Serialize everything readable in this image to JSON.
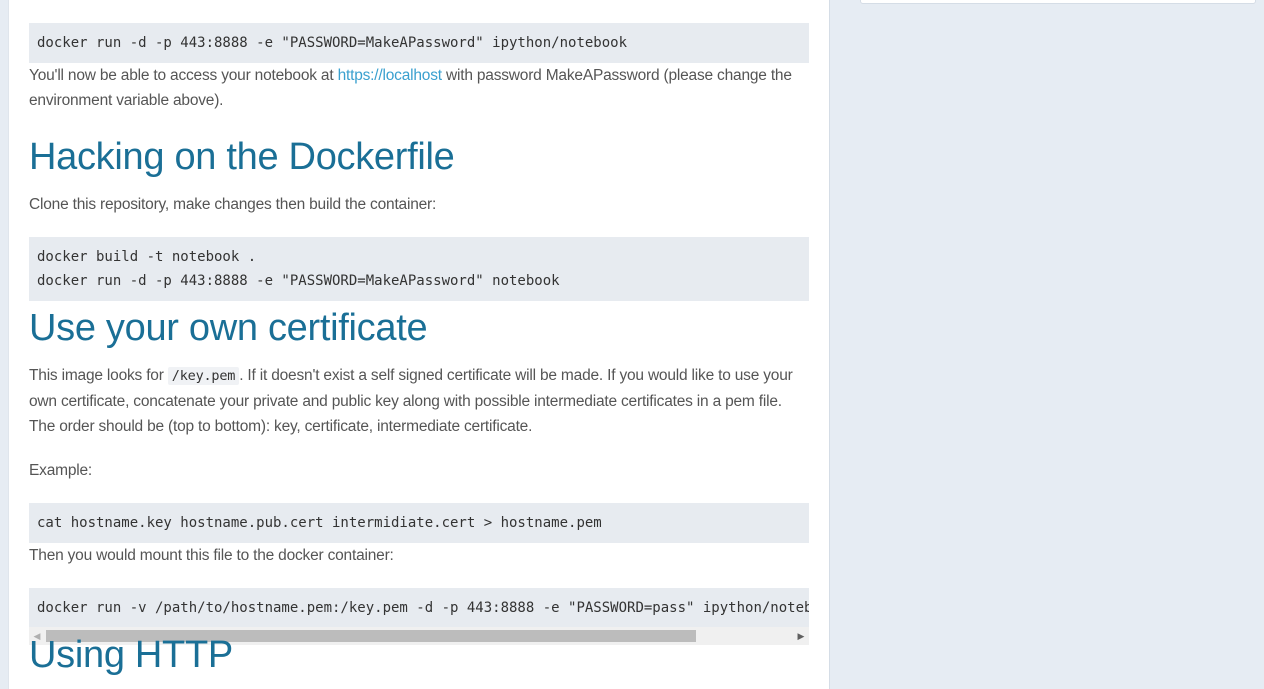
{
  "section_run": {
    "code": "docker run -d -p 443:8888 -e \"PASSWORD=MakeAPassword\" ipython/notebook",
    "para_prefix": "You'll now be able to access your notebook at ",
    "link": "https://localhost",
    "para_suffix": " with password MakeAPassword (please change the environment variable above)."
  },
  "section_hacking": {
    "heading": "Hacking on the Dockerfile",
    "para": "Clone this repository, make changes then build the container:",
    "code": "docker build -t notebook .\ndocker run -d -p 443:8888 -e \"PASSWORD=MakeAPassword\" notebook"
  },
  "section_cert": {
    "heading": "Use your own certificate",
    "para_prefix": "This image looks for ",
    "inline_code": "/key.pem",
    "para_suffix": ". If it doesn't exist a self signed certificate will be made. If you would like to use your own certificate, concatenate your private and public key along with possible intermediate certificates in a pem file. The order should be (top to bottom): key, certificate, intermediate certificate.",
    "example_label": "Example:",
    "code_cat": "cat hostname.key hostname.pub.cert intermidiate.cert > hostname.pem",
    "mount_para": "Then you would mount this file to the docker container:",
    "code_mount": "docker run -v /path/to/hostname.pem:/key.pem -d -p 443:8888 -e \"PASSWORD=pass\" ipython/notebook"
  },
  "section_http": {
    "heading": "Using HTTP"
  },
  "scrollbar": {
    "left_arrow": "◀",
    "right_arrow": "▶"
  },
  "colors": {
    "heading": "#1a6f96",
    "link": "#3aa0cf",
    "code_bg": "#e7ebf0",
    "page_bg": "#e6ecf3"
  }
}
